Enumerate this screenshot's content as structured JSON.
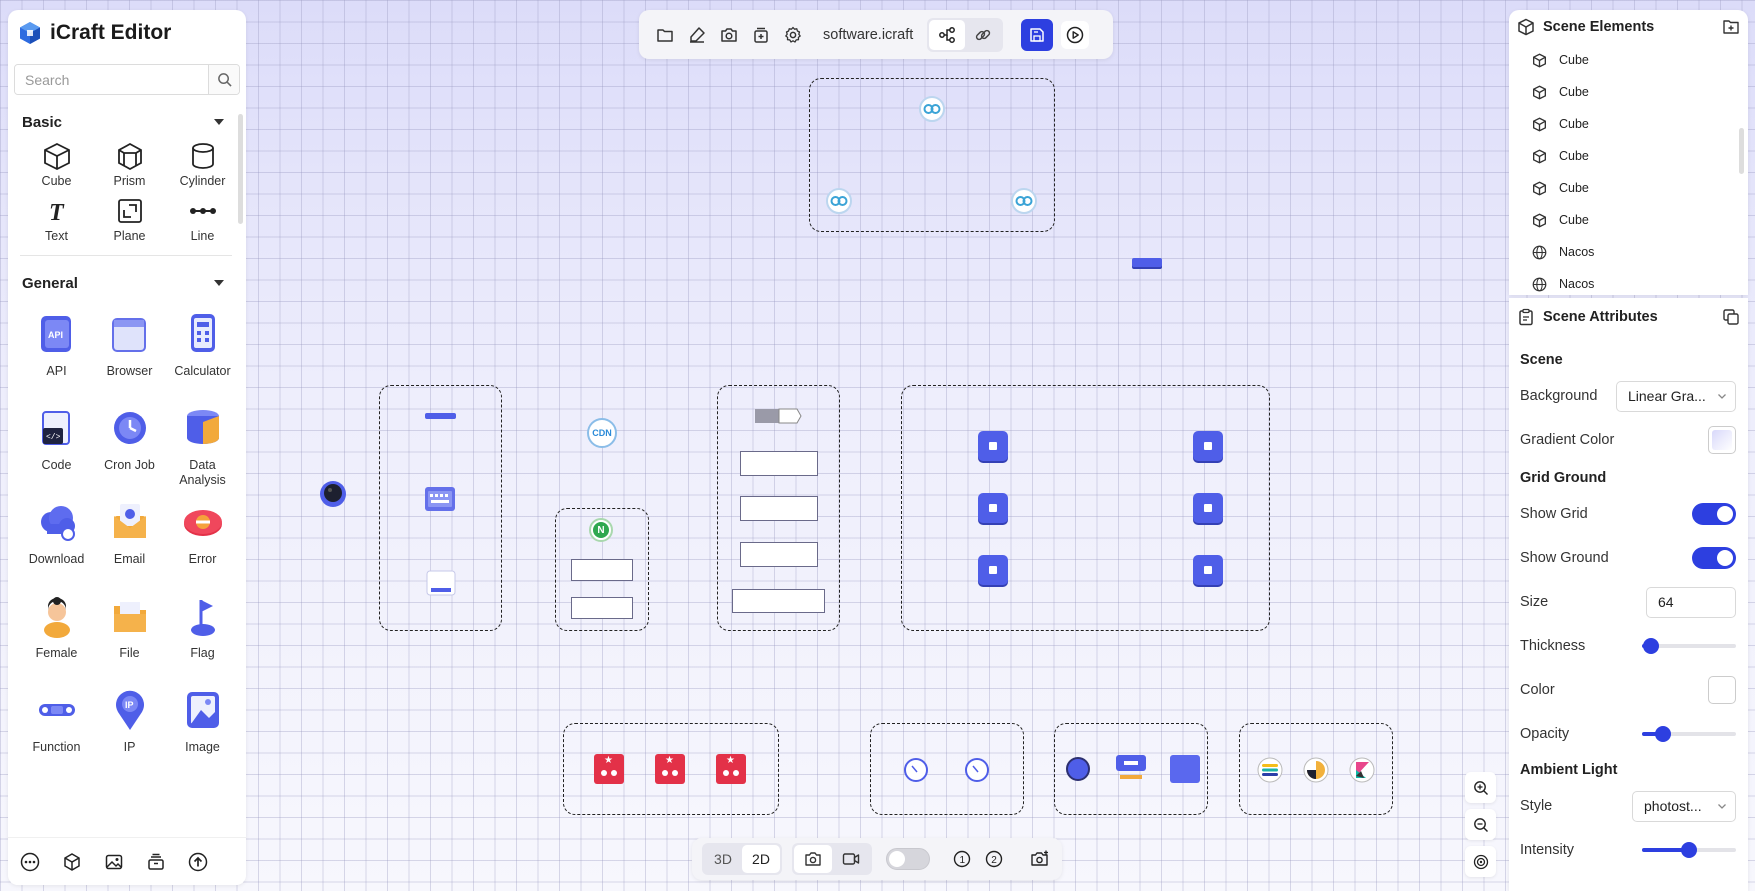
{
  "app": {
    "title": "iCraft Editor"
  },
  "search": {
    "placeholder": "Search"
  },
  "sections": {
    "basic": "Basic",
    "general": "General"
  },
  "basic_tools": [
    {
      "label": "Cube",
      "icon": "cube-icon"
    },
    {
      "label": "Prism",
      "icon": "prism-icon"
    },
    {
      "label": "Cylinder",
      "icon": "cylinder-icon"
    },
    {
      "label": "Text",
      "icon": "text-icon"
    },
    {
      "label": "Plane",
      "icon": "plane-icon"
    },
    {
      "label": "Line",
      "icon": "line-icon"
    }
  ],
  "general_tools": [
    {
      "label": "API",
      "icon": "api-icon"
    },
    {
      "label": "Browser",
      "icon": "browser-icon"
    },
    {
      "label": "Calculator",
      "icon": "calculator-icon"
    },
    {
      "label": "Code",
      "icon": "code-icon"
    },
    {
      "label": "Cron Job",
      "icon": "cron-job-icon"
    },
    {
      "label": "Data Analysis",
      "icon": "data-analysis-icon"
    },
    {
      "label": "Download",
      "icon": "download-icon"
    },
    {
      "label": "Email",
      "icon": "email-icon"
    },
    {
      "label": "Error",
      "icon": "error-icon"
    },
    {
      "label": "Female",
      "icon": "female-icon"
    },
    {
      "label": "File",
      "icon": "file-icon"
    },
    {
      "label": "Flag",
      "icon": "flag-icon"
    },
    {
      "label": "Function",
      "icon": "function-icon"
    },
    {
      "label": "IP",
      "icon": "ip-icon"
    },
    {
      "label": "Image",
      "icon": "image-icon"
    }
  ],
  "toolbar": {
    "filename": "software.icraft"
  },
  "scene_elements": {
    "title": "Scene Elements",
    "items": [
      {
        "label": "Cube",
        "icon": "cube-icon"
      },
      {
        "label": "Cube",
        "icon": "cube-icon"
      },
      {
        "label": "Cube",
        "icon": "cube-icon"
      },
      {
        "label": "Cube",
        "icon": "cube-icon"
      },
      {
        "label": "Cube",
        "icon": "cube-icon"
      },
      {
        "label": "Cube",
        "icon": "cube-icon"
      },
      {
        "label": "Nacos",
        "icon": "globe-icon"
      },
      {
        "label": "Nacos",
        "icon": "globe-icon"
      }
    ]
  },
  "scene_attributes": {
    "title": "Scene Attributes",
    "scene_heading": "Scene",
    "background_label": "Background",
    "background_value": "Linear Gra...",
    "gradient_color_label": "Gradient Color",
    "grid_ground_heading": "Grid Ground",
    "show_grid_label": "Show Grid",
    "show_grid": true,
    "show_ground_label": "Show Ground",
    "show_ground": true,
    "size_label": "Size",
    "size_value": "64",
    "thickness_label": "Thickness",
    "thickness": 0.1,
    "color_label": "Color",
    "opacity_label": "Opacity",
    "opacity": 0.22,
    "ambient_light_heading": "Ambient Light",
    "style_label": "Style",
    "style_value": "photost...",
    "intensity_label": "Intensity",
    "intensity": 0.5
  },
  "bottom_toolbar": {
    "mode_3d": "3D",
    "mode_2d": "2D",
    "active_mode": "2D"
  },
  "colors": {
    "accent": "#2d3fe0",
    "object_blue": "#4f5ee8",
    "object_red": "#e33148"
  },
  "canvas": {
    "cdn_label": "CDN",
    "nginx_label": "N"
  }
}
